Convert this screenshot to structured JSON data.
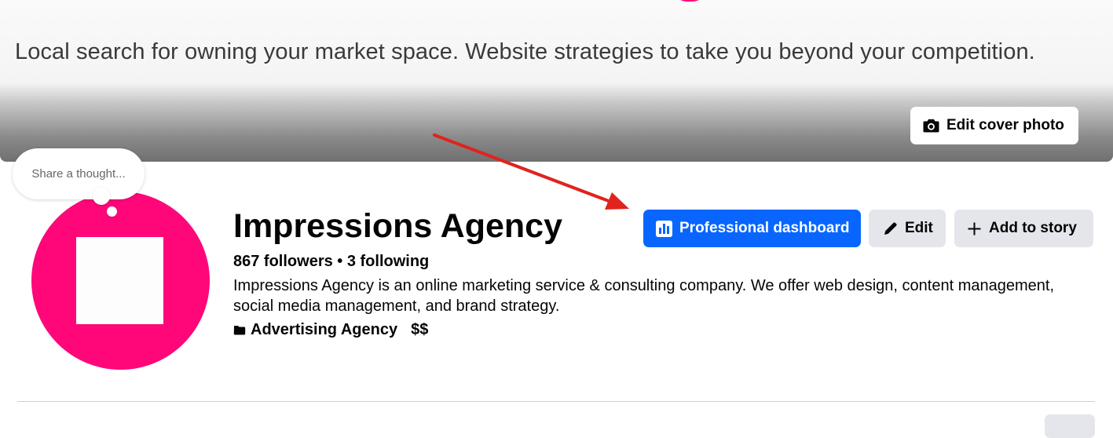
{
  "cover": {
    "tagline": "Local search for owning your market space. Website strategies to take you beyond your competition.",
    "edit_cover_label": "Edit cover photo"
  },
  "thought": {
    "placeholder": "Share a thought..."
  },
  "profile": {
    "name": "Impressions Agency",
    "stats": "867 followers • 3 following",
    "bio": "Impressions Agency is an online marketing service & consulting company. We offer web design, content management, social media management, and brand strategy.",
    "category": "Advertising Agency",
    "price_range": "$$"
  },
  "actions": {
    "professional_dashboard": "Professional dashboard",
    "edit": "Edit",
    "add_to_story": "Add to story"
  },
  "colors": {
    "brand_pink": "#ff0779",
    "primary_blue": "#0866ff",
    "annotation_red": "#e0231f",
    "secondary_button": "#e4e6eb"
  },
  "icons": {
    "camera": "camera-icon",
    "dashboard": "bar-chart-icon",
    "edit": "pencil-icon",
    "add": "plus-icon",
    "category": "category-icon"
  }
}
